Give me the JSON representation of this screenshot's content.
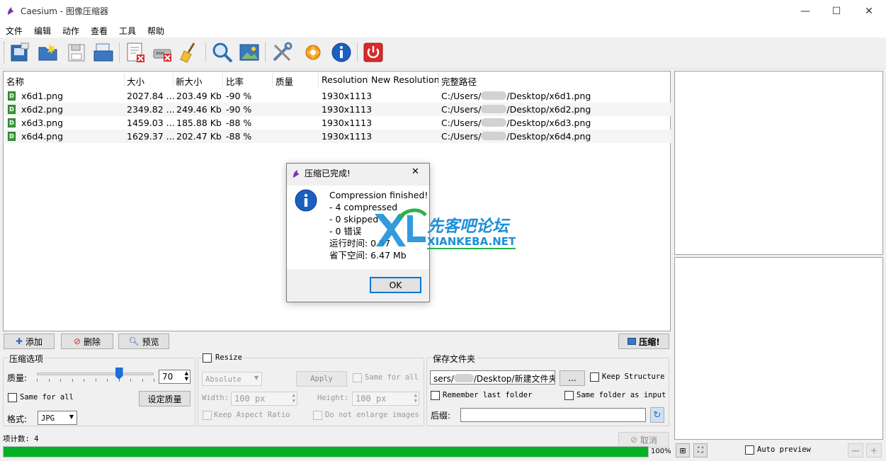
{
  "window": {
    "title": "Caesium - 图像压缩器",
    "minimize": "—",
    "maximize": "☐",
    "close": "✕"
  },
  "menu": [
    "文件",
    "编辑",
    "动作",
    "查看",
    "工具",
    "帮助"
  ],
  "toolbar": [
    {
      "icon": "add-files-icon"
    },
    {
      "icon": "open-folder-icon"
    },
    {
      "icon": "save-list-icon"
    },
    {
      "icon": "open-list-icon"
    },
    {
      "icon": "remove-item-icon"
    },
    {
      "icon": "clear-list-icon"
    },
    {
      "icon": "broom-icon"
    },
    {
      "icon": "magnifier-icon"
    },
    {
      "icon": "image-preview-icon"
    },
    {
      "icon": "tools-settings-icon"
    },
    {
      "icon": "update-icon"
    },
    {
      "icon": "info-icon"
    },
    {
      "icon": "power-icon"
    }
  ],
  "table": {
    "columns": [
      "名称",
      "大小",
      "新大小",
      "比率",
      "质量",
      "Resolution",
      "New Resolution",
      "完整路径"
    ],
    "rows": [
      {
        "name": "x6d1.png",
        "size": "2027.84 ...",
        "new_size": "203.49 Kb",
        "ratio": "-90 %",
        "quality": "",
        "resolution": "1930x1113",
        "new_resolution": "",
        "path_prefix": "C:/Users/",
        "path_suffix": "/Desktop/x6d1.png"
      },
      {
        "name": "x6d2.png",
        "size": "2349.82 ...",
        "new_size": "249.46 Kb",
        "ratio": "-90 %",
        "quality": "",
        "resolution": "1930x1113",
        "new_resolution": "",
        "path_prefix": "C:/Users/",
        "path_suffix": "/Desktop/x6d2.png"
      },
      {
        "name": "x6d3.png",
        "size": "1459.03 ...",
        "new_size": "185.88 Kb",
        "ratio": "-88 %",
        "quality": "",
        "resolution": "1930x1113",
        "new_resolution": "",
        "path_prefix": "C:/Users/",
        "path_suffix": "/Desktop/x6d3.png"
      },
      {
        "name": "x6d4.png",
        "size": "1629.37 ...",
        "new_size": "202.47 Kb",
        "ratio": "-88 %",
        "quality": "",
        "resolution": "1930x1113",
        "new_resolution": "",
        "path_prefix": "C:/Users/",
        "path_suffix": "/Desktop/x6d4.png"
      }
    ]
  },
  "actions": {
    "add": "添加",
    "delete": "删除",
    "preview": "预览",
    "compress": "压缩!"
  },
  "compression": {
    "title": "压缩选项",
    "quality_label": "质量:",
    "quality_value": "70",
    "quality_slider_fraction": 0.7,
    "same_for_all": "Same for all",
    "set_quality": "设定质量",
    "format_label": "格式:",
    "format_value": "JPG"
  },
  "resize": {
    "title": "Resize",
    "mode": "Absolute",
    "apply": "Apply",
    "same_for_all": "Same for all",
    "width_label": "Width:",
    "width_value": "100 px",
    "height_label": "Height:",
    "height_value": "100 px",
    "keep_aspect": "Keep Aspect Ratio",
    "no_enlarge": "Do not enlarge images"
  },
  "output": {
    "title": "保存文件夹",
    "folder_prefix": "sers/",
    "folder_suffix": "/Desktop/新建文件夹",
    "browse": "...",
    "keep_structure": "Keep Structure",
    "remember_last": "Remember last folder",
    "same_folder": "Same folder as input",
    "suffix_label": "后缀:",
    "suffix_value": ""
  },
  "status": {
    "item_count": "项计数: 4",
    "cancel": "取消",
    "progress_fraction": 1.0,
    "progress_text": "100%"
  },
  "preview_panel": {
    "auto_preview": "Auto preview"
  },
  "dialog": {
    "title": "压缩已完成!",
    "lines": [
      "Compression finished!",
      "- 4 compressed",
      "- 0 skipped",
      "- 0 错误",
      "运行时间: 0.57",
      "省下空间: 6.47 Mb"
    ],
    "ok": "OK",
    "close": "✕"
  },
  "watermark": {
    "cn": "先客吧论坛",
    "en": "XIANKEBA.NET"
  },
  "colors": {
    "progress": "#06b025",
    "info_blue": "#1b5fc1",
    "ok_border": "#0078d7"
  }
}
